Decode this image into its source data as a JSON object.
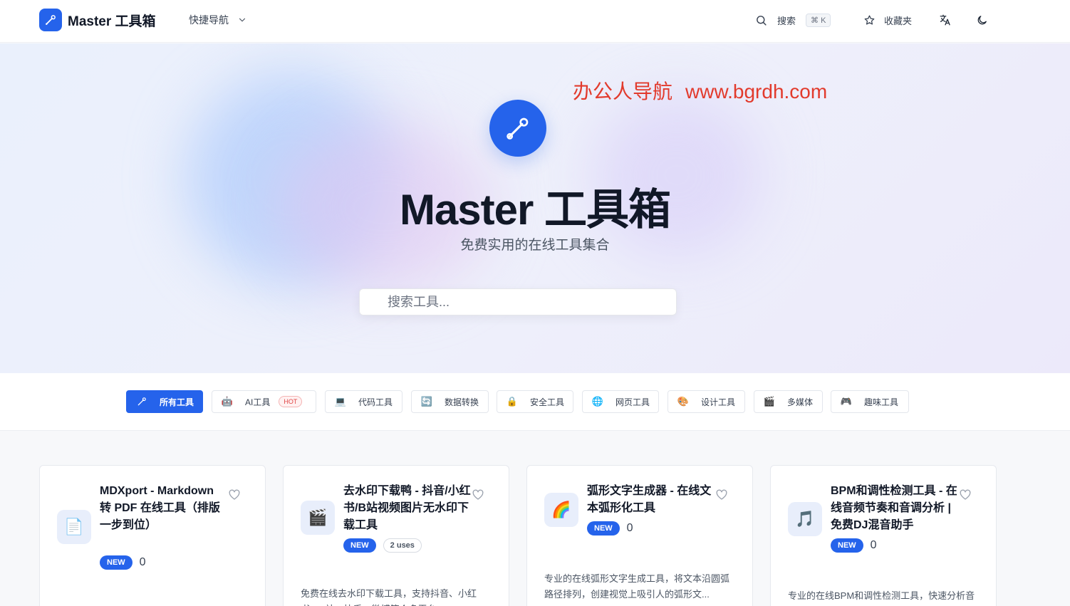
{
  "header": {
    "brand": "Master 工具箱",
    "quick_nav": "快捷导航",
    "search_label": "搜索",
    "search_shortcut": "⌘ K",
    "favorites_label": "收藏夹"
  },
  "hero": {
    "watermark_cn": "办公人导航",
    "watermark_url": "www.bgrdh.com",
    "title": "Master 工具箱",
    "subtitle": "免费实用的在线工具集合",
    "search_placeholder": "搜索工具..."
  },
  "categories": [
    {
      "label": "所有工具",
      "icon": "wrench-icon",
      "active": true
    },
    {
      "label": "AI工具",
      "icon": "robot-icon",
      "badge": "HOT"
    },
    {
      "label": "代码工具",
      "icon": "laptop-icon"
    },
    {
      "label": "数据转换",
      "icon": "refresh-icon"
    },
    {
      "label": "安全工具",
      "icon": "lock-icon"
    },
    {
      "label": "网页工具",
      "icon": "globe-icon"
    },
    {
      "label": "设计工具",
      "icon": "palette-icon"
    },
    {
      "label": "多媒体",
      "icon": "clapper-icon"
    },
    {
      "label": "趣味工具",
      "icon": "gamepad-icon"
    }
  ],
  "cards": [
    {
      "title": "MDXport - Markdown 转 PDF 在线工具（排版一步到位）",
      "icon": "document-icon",
      "badge": "NEW",
      "count": "0",
      "description": ""
    },
    {
      "title": "去水印下载鸭 - 抖音/小红书/B站视频图片无水印下载工具",
      "icon": "clapper-icon",
      "badge": "NEW",
      "uses": "2 uses",
      "description": "免费在线去水印下载工具，支持抖音、小红书、B站、快手、微博等众多平台"
    },
    {
      "title": "弧形文字生成器 - 在线文本弧形化工具",
      "icon": "rainbow-icon",
      "badge": "NEW",
      "count": "0",
      "description": "专业的在线弧形文字生成工具，将文本沿圆弧路径排列，创建视觉上吸引人的弧形文..."
    },
    {
      "title": "BPM和调性检测工具 - 在线音频节奏和音调分析 | 免费DJ混音助手",
      "icon": "music-icon",
      "badge": "NEW",
      "count": "0",
      "description": "专业的在线BPM和调性检测工具，快速分析音频文件的节奏和调性信息"
    }
  ],
  "colors": {
    "accent": "#2563eb",
    "watermark": "#e23a2c",
    "hot": "#e04545"
  }
}
